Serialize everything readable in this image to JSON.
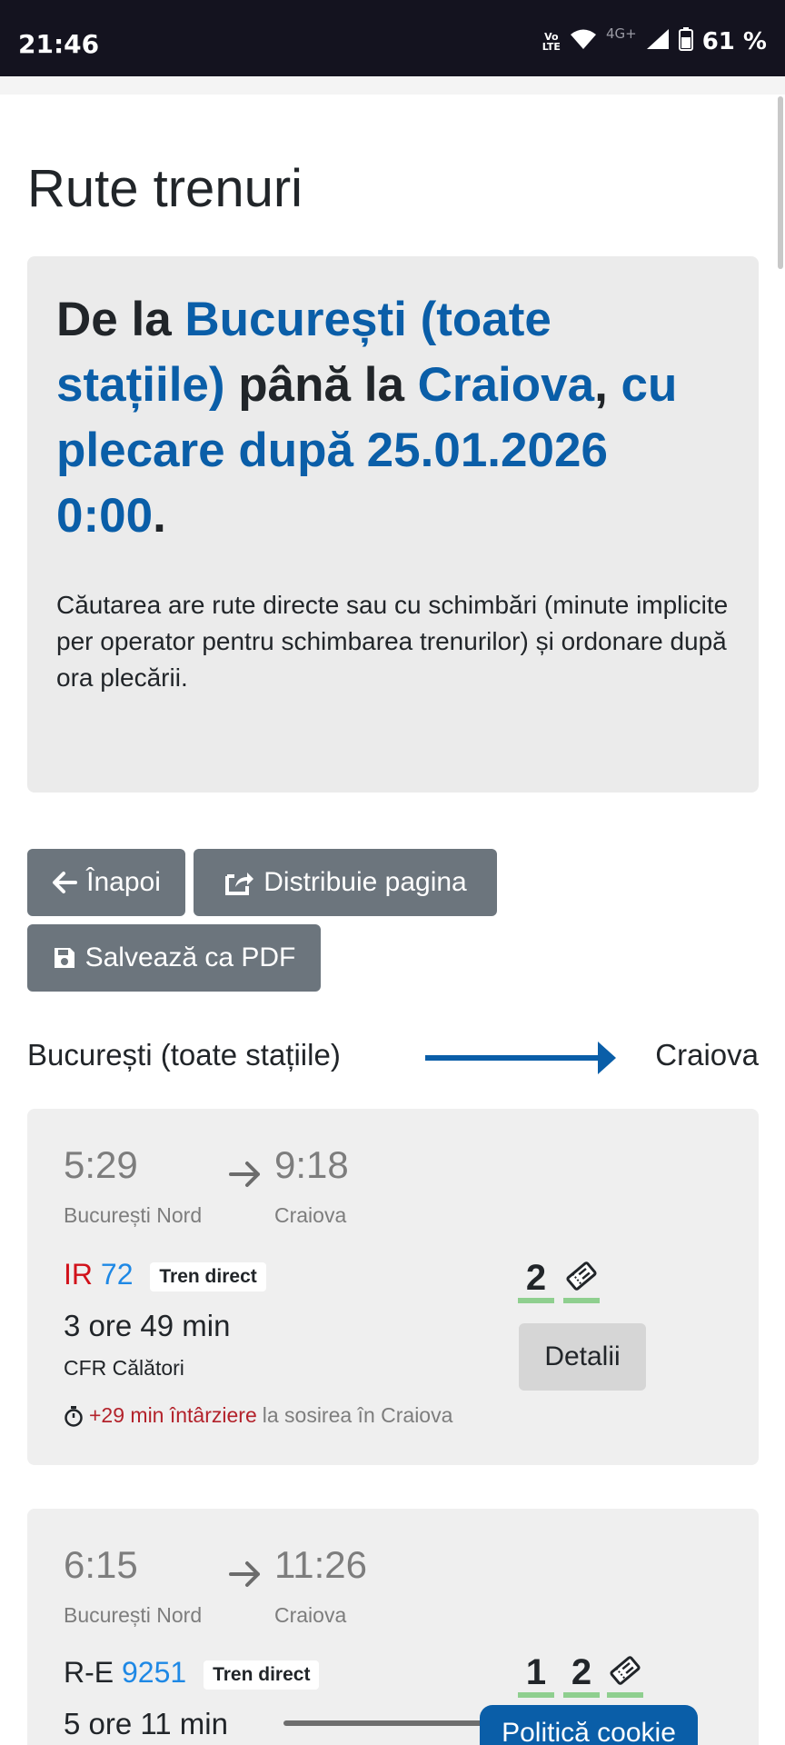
{
  "status_bar": {
    "time": "21:46",
    "volte_top": "Vo",
    "volte_bottom": "LTE",
    "network": "4G+",
    "battery": "61 %"
  },
  "page_title": "Rute trenuri",
  "summary": {
    "p1": "De la ",
    "from": "București (toate stațiile)",
    "p2": " până la ",
    "to": "Craiova",
    "p3": ",",
    "when": "cu plecare după 25.01.2026 0:00",
    "p4": ".",
    "note": "Căutarea are rute directe sau cu schimbări (minute implicite per operator pentru schimbarea trenurilor) și ordonare după ora plecării."
  },
  "actions": {
    "back": "Înapoi",
    "share": "Distribuie pagina",
    "pdf": "Salvează ca PDF"
  },
  "route": {
    "from": "București (toate stațiile)",
    "to": "Craiova"
  },
  "trips": [
    {
      "dep_time": "5:29",
      "dep_station": "București Nord",
      "arr_time": "9:18",
      "arr_station": "Craiova",
      "category": "IR",
      "number": "72",
      "badge": "Tren direct",
      "duration": "3 ore 49 min",
      "operator": "CFR Călători",
      "delay": "+29 min întârziere",
      "delay_suffix": "la sosirea în Craiova",
      "classes": [
        "2"
      ],
      "details": "Detalii"
    },
    {
      "dep_time": "6:15",
      "dep_station": "București Nord",
      "arr_time": "11:26",
      "arr_station": "Craiova",
      "category": "R-E",
      "number": "9251",
      "badge": "Tren direct",
      "duration": "5 ore 11 min",
      "classes": [
        "1",
        "2"
      ]
    }
  ],
  "cookie": "Politică cookie",
  "colors": {
    "accent": "#0a5ea8",
    "delay_red": "#b3222b",
    "ir_red": "#d1111a",
    "train_number_blue": "#1e88e5",
    "class_green": "#8fcf8f",
    "button_grey": "#6c757d"
  }
}
